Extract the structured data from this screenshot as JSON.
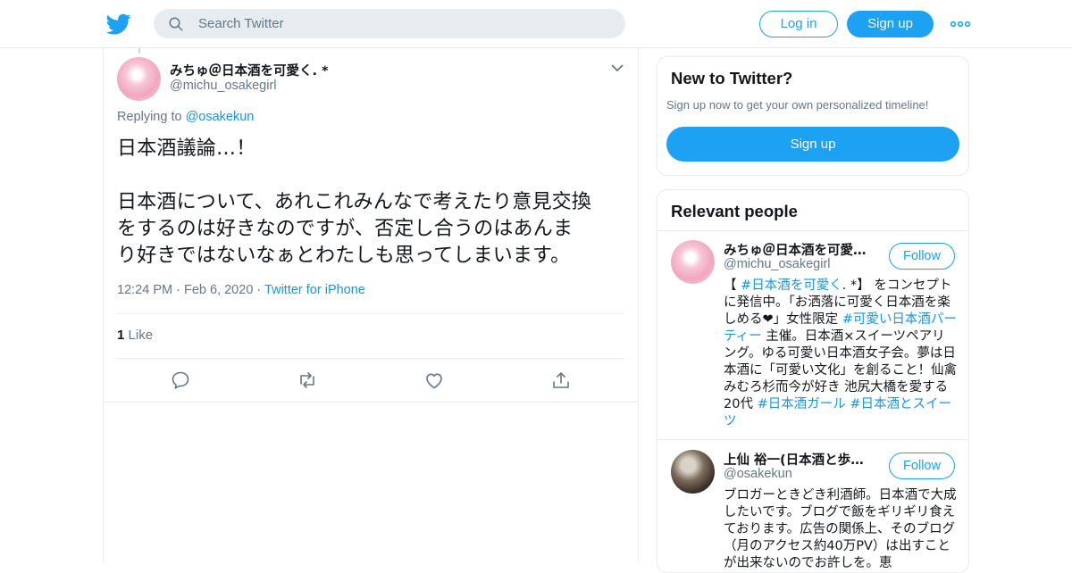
{
  "header": {
    "search_placeholder": "Search Twitter",
    "login_label": "Log in",
    "signup_label": "Sign up",
    "accent_color": "#1da1f2"
  },
  "tweet": {
    "author_name": "みちゅ＠日本酒を可愛く. *",
    "author_handle": "@michu_osakegirl",
    "replying_prefix": "Replying to",
    "replying_to": "@osakekun",
    "text_line1": "日本酒議論…！",
    "text_body": "日本酒について、あれこれみんなで考えたり意見交換\nをするのは好きなのですが、否定し合うのはあんま\nり好きではないなぁとわたしも思ってしまいます。",
    "time": "12:24 PM",
    "date": "Feb 6, 2020",
    "source": "Twitter for iPhone",
    "like_count": "1",
    "like_label": "Like"
  },
  "sidebar": {
    "new_title": "New to Twitter?",
    "new_sub": "Sign up now to get your own personalized timeline!",
    "signup_label": "Sign up",
    "relevant_title": "Relevant people",
    "people": [
      {
        "name": "みちゅ＠日本酒を可愛く. *",
        "handle": "@michu_osakegirl",
        "follow_label": "Follow",
        "bio": [
          {
            "t": "【 ",
            "h": false
          },
          {
            "t": "#日本酒を可愛く",
            "h": true
          },
          {
            "t": ". *】 をコンセプトに発信中。「お洒落に可愛く日本酒を楽しめる❤」女性限定 ",
            "h": false
          },
          {
            "t": "#可愛い日本酒パーティー",
            "h": true
          },
          {
            "t": " 主催。日本酒×スイーツペアリング。ゆる可愛い日本酒女子会。夢は日本酒に「可愛い文化」を創ること！仙禽みむろ杉而今が好き 池尻大橋を愛する20代 ",
            "h": false
          },
          {
            "t": "#日本酒ガール",
            "h": true
          },
          {
            "t": " ",
            "h": false
          },
          {
            "t": "#日本酒とスイーツ",
            "h": true
          }
        ]
      },
      {
        "name": "上仙 裕一(日本酒と歩む人生)",
        "handle": "@osakekun",
        "follow_label": "Follow",
        "bio": [
          {
            "t": "ブロガーときどき利酒師。日本酒で大成したいです。ブログで飯をギリギリ食えております。広告の関係上、そのブログ（月のアクセス約40万PV）は出すことが出来ないのでお許しを。恵",
            "h": false
          }
        ]
      }
    ]
  }
}
